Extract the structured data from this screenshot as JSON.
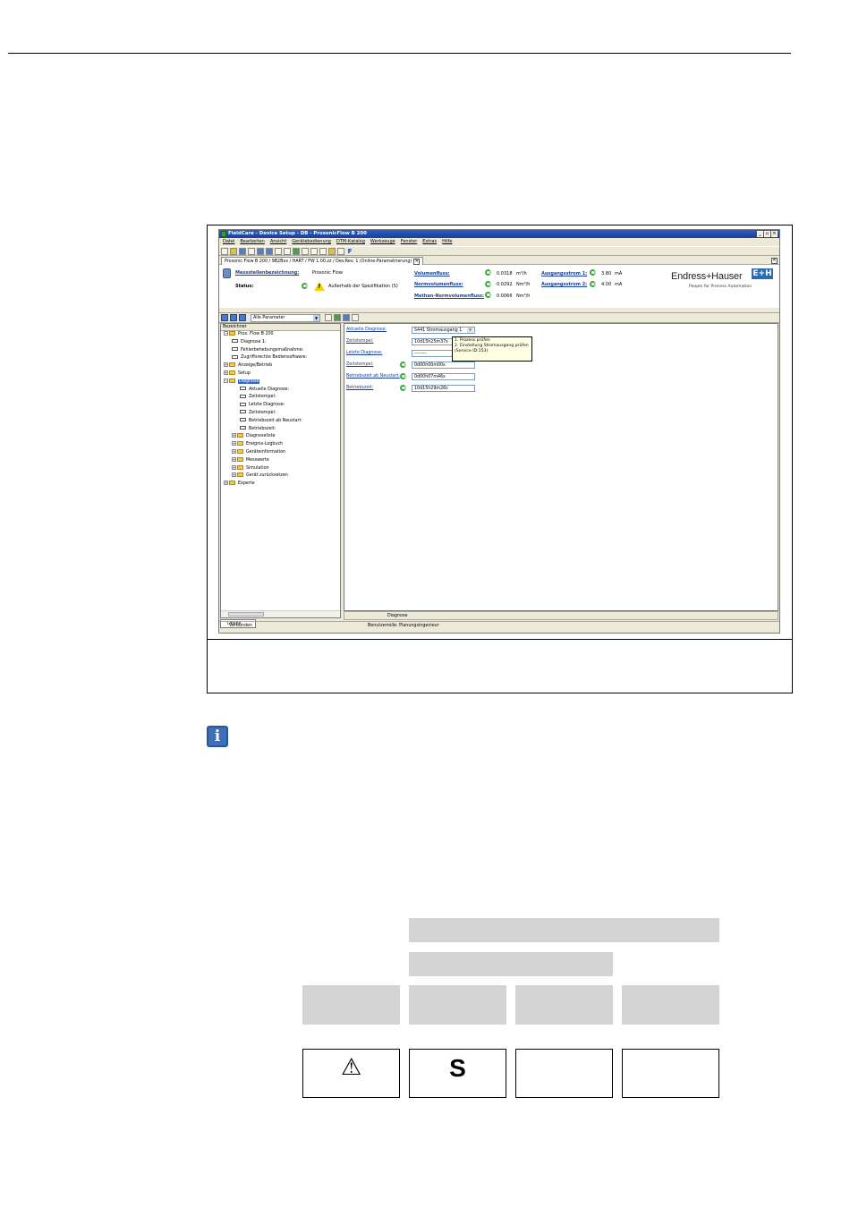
{
  "window": {
    "title": "FieldCare - Device Setup - DB - ProsonicFlow B 200",
    "controls": [
      "_",
      "▫",
      "✕"
    ]
  },
  "menu": [
    "Datei",
    "Bearbeiten",
    "Ansicht",
    "Gerätebedienung",
    "DTM-Katalog",
    "Werkzeuge",
    "Fenster",
    "Extras",
    "Hilfe"
  ],
  "toolbar": {
    "f_label": "F"
  },
  "doc_tab": {
    "label": "Prosonic Flow B 200 / 9B2Bxx / HART / FW 1.00.zz / Dev.Rev. 1 (Online-Parametrierung)",
    "close": "✕"
  },
  "header": {
    "tag_label": "Messstellenbezeichnung:",
    "tag_value": "Prosonic Flow",
    "status_label": "Status:",
    "status_value": "Außerhalb der Spezifikation (S)",
    "col2": [
      {
        "label": "Volumenfluss:",
        "value": "0.0318",
        "unit": "m³/h"
      },
      {
        "label": "Normvolumenfluss:",
        "value": "0.0292",
        "unit": "Nm³/h"
      },
      {
        "label": "Methan-Normvolumenfluss:",
        "value": "0.0066",
        "unit": "Nm³/h"
      }
    ],
    "col3": [
      {
        "label": "Ausgangsstrom 1:",
        "value": "3.80",
        "unit": "mA"
      },
      {
        "label": "Ausgangsstrom 2:",
        "value": "4.00",
        "unit": "mA"
      }
    ],
    "brand": "Endress+Hauser",
    "brand_box": "E+H",
    "brand_tagline": "People for Process Automation"
  },
  "panebar": {
    "filter": "Alle Parameter"
  },
  "tree": {
    "header": "Bezeichner",
    "nodes": [
      {
        "label": "Pros. Flow B 200",
        "indent": 0,
        "kind": "folder",
        "pm": "−"
      },
      {
        "label": "Diagnose 1:",
        "indent": 1,
        "kind": "param"
      },
      {
        "label": "Fehlerbehebungsmaßnahme:",
        "indent": 1,
        "kind": "param"
      },
      {
        "label": "Zugriffsrechte Bediensoftware:",
        "indent": 1,
        "kind": "param"
      },
      {
        "label": "Anzeige/Betrieb",
        "indent": 0,
        "kind": "folder",
        "pm": "+"
      },
      {
        "label": "Setup",
        "indent": 0,
        "kind": "folder",
        "pm": "+"
      },
      {
        "label": "Diagnose",
        "indent": 0,
        "kind": "folder",
        "pm": "−",
        "selected": true
      },
      {
        "label": "Aktuelle Diagnose:",
        "indent": 2,
        "kind": "param"
      },
      {
        "label": "Zeitstempel:",
        "indent": 2,
        "kind": "param"
      },
      {
        "label": "Letzte Diagnose:",
        "indent": 2,
        "kind": "param"
      },
      {
        "label": "Zeitstempel:",
        "indent": 2,
        "kind": "param"
      },
      {
        "label": "Betriebszeit ab Neustart:",
        "indent": 2,
        "kind": "param"
      },
      {
        "label": "Betriebszeit:",
        "indent": 2,
        "kind": "param"
      },
      {
        "label": "Diagnoseliste",
        "indent": 1,
        "kind": "folder",
        "pm": "+"
      },
      {
        "label": "Ereignis-Logbuch",
        "indent": 1,
        "kind": "folder",
        "pm": "+"
      },
      {
        "label": "Geräteinformation",
        "indent": 1,
        "kind": "folder",
        "pm": "+"
      },
      {
        "label": "Messwerte",
        "indent": 1,
        "kind": "folder",
        "pm": "+"
      },
      {
        "label": "Simulation",
        "indent": 1,
        "kind": "folder",
        "pm": "+"
      },
      {
        "label": "Gerät zurücksetzen",
        "indent": 1,
        "kind": "folder",
        "pm": "+"
      },
      {
        "label": "Experte",
        "indent": 0,
        "kind": "folder",
        "pm": "+"
      }
    ]
  },
  "params": [
    {
      "label": "Aktuelle Diagnose:",
      "value": "S441 Stromausgang 1",
      "refresh": false,
      "combo": true
    },
    {
      "label": "Zeitstempel:",
      "value": "10d15h25m37s",
      "refresh": false
    },
    {
      "label": "Letzte Diagnose:",
      "value": "--------",
      "refresh": false
    },
    {
      "label": "Zeitstempel:",
      "value": "0d00h00m00s",
      "refresh": true
    },
    {
      "label": "Betriebszeit ab Neustart:",
      "value": "0d00h07m46s",
      "refresh": true
    },
    {
      "label": "Betriebszeit:",
      "value": "10d15h29m26s",
      "refresh": true
    }
  ],
  "tooltip": [
    "1. Prozess prüfen",
    "2. Einstellung Stromausgang prüfen",
    "(Service ID:153)"
  ],
  "online_tab": "Online",
  "navbar": {
    "crumb": "Diagnose"
  },
  "statusbar": {
    "connected": "Verbunden",
    "role": "Benutzerrolle: Planungsingenieur"
  },
  "symbols": {
    "warning": "⚠",
    "status_s": "S",
    "info": "i"
  }
}
